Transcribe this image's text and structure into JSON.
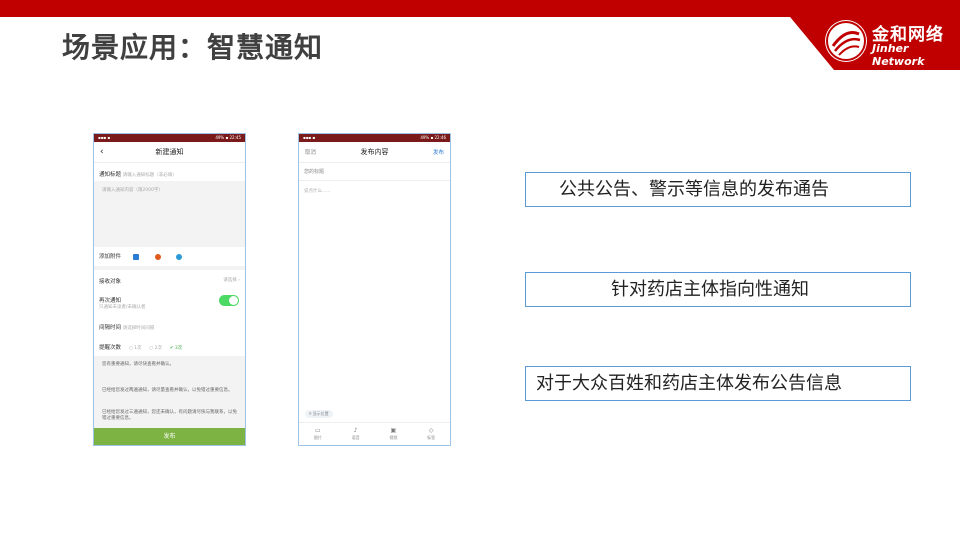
{
  "slide": {
    "title": "场景应用：智慧通知",
    "logo": {
      "cn": "金和网络",
      "en": "Jinher Network"
    }
  },
  "colors": {
    "brand_red": "#c00000",
    "box_border": "#5b9bd5",
    "publish_green": "#7cb342"
  },
  "phone1": {
    "status_left": "▪▪▪ ▪",
    "status_right": "49% ▪ 22:45",
    "nav_back": "‹",
    "nav_title": "新建通知",
    "title_label": "通知标题",
    "title_placeholder": "请输入通知标题（非必填）",
    "content_placeholder": "请输入通知内容（限2000字）",
    "attach_label": "添加附件",
    "receiver_label": "接收对象",
    "receiver_value": "请选择 ›",
    "repeat_label": "再次通知",
    "repeat_sub": "只通知未读者/未确认者",
    "interval_label": "间隔时间",
    "interval_placeholder": "请选择时间间隔",
    "remind_label": "提醒次数",
    "remind_opt1": "○ 1次",
    "remind_opt2": "○ 2次",
    "remind_opt3": "✔ 3次",
    "msg1": "您有重要通知，请尽快查看并确认。",
    "msg2": "已经给您发过两遍通知，请尽量查看并确认，以免错过重要信息。",
    "msg3": "已经给您发过三遍通知，您还未确认，有问题请尽快与我联系，以免错过重要信息。",
    "publish": "发布"
  },
  "phone2": {
    "status_left": "▪▪▪ ▪",
    "status_right": "49% ▪ 22:46",
    "nav_cancel": "取消",
    "nav_title": "发布内容",
    "nav_publish": "发布",
    "title_placeholder": "您的标题",
    "body_placeholder": "说点什么......",
    "location": "显示位置",
    "tabs": [
      "图片",
      "语音",
      "视频",
      "标签"
    ]
  },
  "boxes": [
    "公共公告、警示等信息的发布通告",
    "针对药店主体指向性通知",
    "对于大众百姓和药店主体发布公告信息"
  ]
}
